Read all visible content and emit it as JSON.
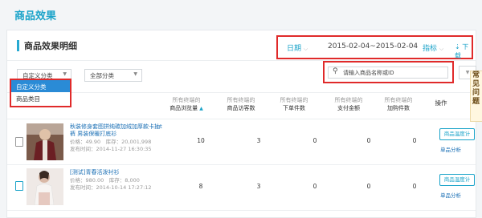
{
  "page_title": "商品效果",
  "panel": {
    "title": "商品效果明细",
    "date_label": "日期",
    "date_range": "2015-02-04~2015-02-04",
    "metric_label": "指标",
    "download_label": "下载"
  },
  "filters": {
    "custom_category": "自定义分类",
    "all_category": "全部分类",
    "dropdown_options": [
      "自定义分类",
      "商品类目"
    ],
    "search_placeholder": "请输入商品名称或ID",
    "side_ad_text": "常见问题"
  },
  "table": {
    "columns": [
      {
        "sub": "所有终端的",
        "main": "商品浏览量",
        "sortable": true
      },
      {
        "sub": "所有终端的",
        "main": "商品访客数",
        "sortable": false
      },
      {
        "sub": "所有终端的",
        "main": "下单件数",
        "sortable": false
      },
      {
        "sub": "所有终端的",
        "main": "支付金额",
        "sortable": false
      },
      {
        "sub": "所有终端的",
        "main": "加购件数",
        "sortable": false
      }
    ],
    "op_header": "操作",
    "rows": [
      {
        "name": "秋装修身套图拼纯碳加绒加厚款卡抽t裤 男装保暖打底衫",
        "price": "价格：49.90　库存：20,001,998",
        "date": "发布时间：2014-11-27 16:30:35",
        "values": [
          "10",
          "3",
          "0",
          "0",
          "0"
        ],
        "btn": "商品温度计",
        "link": "单品分析"
      },
      {
        "name": "[测试]青春活泼衬衫",
        "price": "价格：980.00　库存：8,000",
        "date": "发布时间：2014-10-14 17:27:12",
        "values": [
          "8",
          "3",
          "0",
          "0",
          "0"
        ],
        "btn": "商品温度计",
        "link": "单品分析"
      }
    ]
  },
  "colors": {
    "accent": "#1aa3c9",
    "highlight": "#e02a2a",
    "link": "#1a6fb5"
  }
}
